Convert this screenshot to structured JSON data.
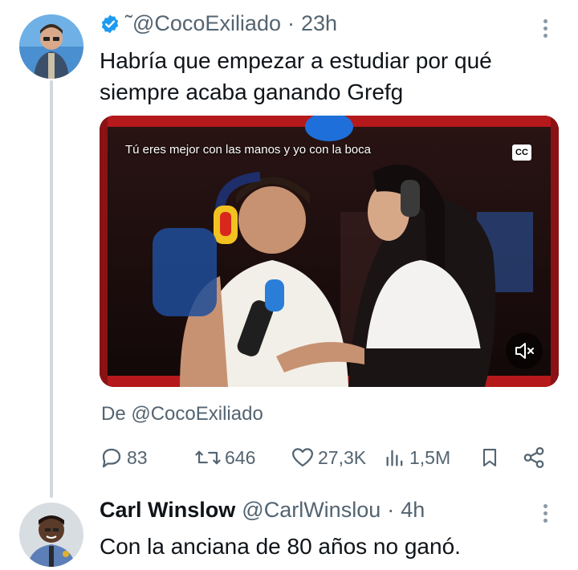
{
  "tweet1": {
    "handle": "˜@CocoExiliado",
    "separator": "·",
    "time": "23h",
    "text": "Habría que empezar a estudiar por qué siempre acaba ganando Grefg",
    "media": {
      "caption": "Tú eres mejor con las manos y yo con la boca",
      "cc_label": "CC",
      "icons": [
        "cc-icon",
        "mute-icon"
      ]
    },
    "from_text": "De @CocoExiliado",
    "actions": {
      "replies": "83",
      "retweets": "646",
      "likes": "27,3K",
      "views": "1,5M"
    }
  },
  "tweet2": {
    "name": "Carl Winslow",
    "handle": "@CarlWinslou",
    "separator": "·",
    "time": "4h",
    "text": "Con la anciana de 80 años no ganó."
  },
  "colors": {
    "secondary_text": "#536471",
    "verified_blue": "#1d9bf0",
    "thread_line": "#cfd9de"
  }
}
